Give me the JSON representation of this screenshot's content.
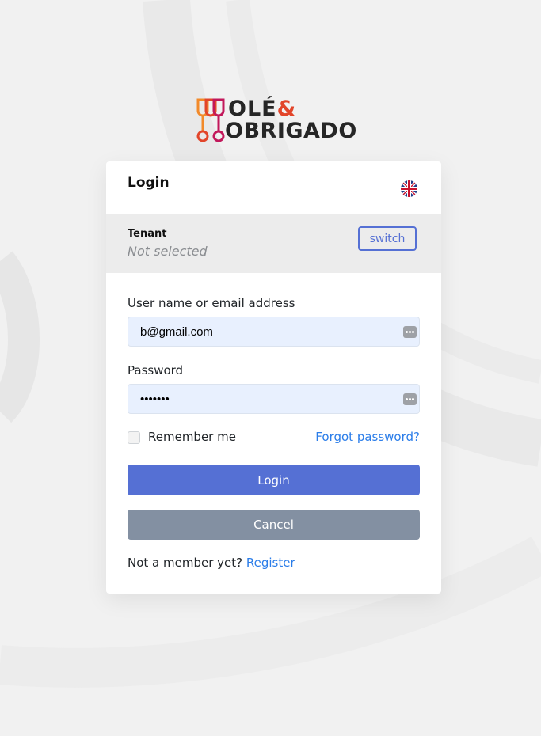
{
  "brand": {
    "line1": "OLÉ",
    "amp": "&",
    "line2": "OBRIGADO"
  },
  "login_card": {
    "title": "Login",
    "language_flag": "uk-flag-icon"
  },
  "tenant": {
    "label": "Tenant",
    "value": "Not selected",
    "switch_label": "switch"
  },
  "form": {
    "username_label": "User name or email address",
    "username_value": "b@gmail.com",
    "password_label": "Password",
    "password_value": "•••••••",
    "remember_label": "Remember me",
    "remember_checked": false,
    "forgot_link": "Forgot password?",
    "login_button": "Login",
    "cancel_button": "Cancel",
    "not_member_text": "Not a member yet?",
    "register_link": "Register"
  },
  "colors": {
    "primary": "#5570d4",
    "secondary": "#8390a2",
    "link": "#2b7de9",
    "autofill_bg": "#e8f0fe",
    "brand_orange": "#e2452a",
    "brand_magenta": "#c2185b"
  }
}
